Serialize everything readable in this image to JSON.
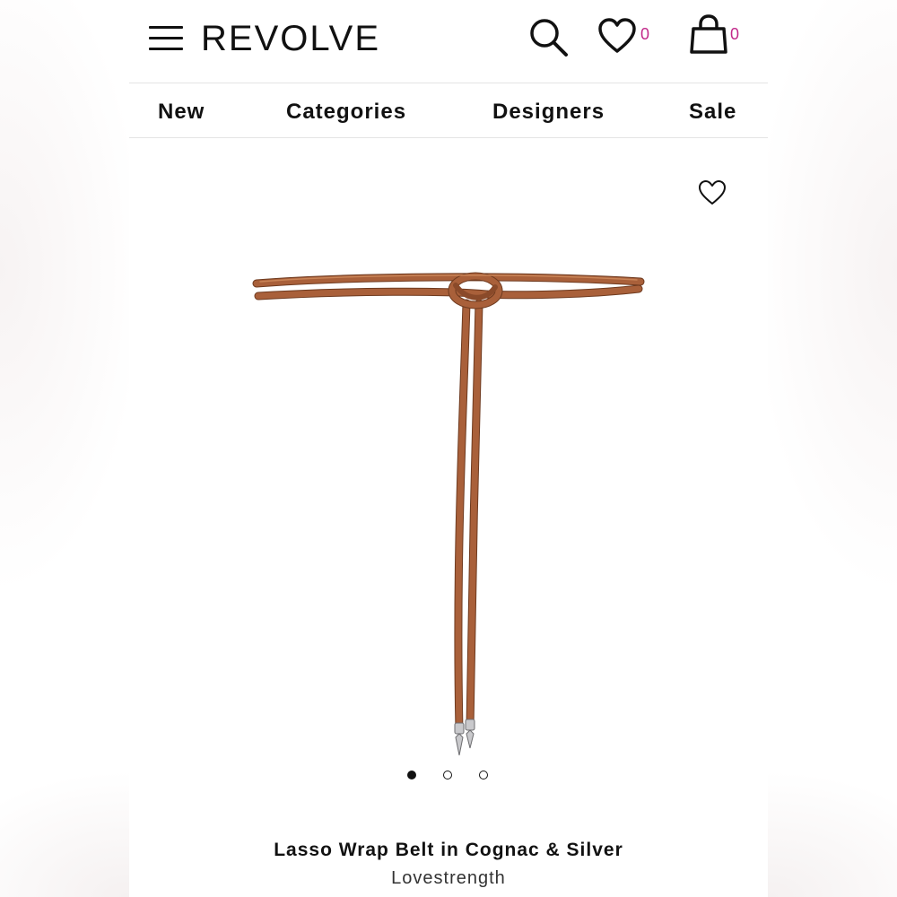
{
  "header": {
    "logo": "REVOLVE",
    "wishlist_count": "0",
    "bag_count": "0",
    "icons": {
      "menu": "hamburger-menu-icon",
      "search": "search-icon",
      "wishlist": "heart-icon",
      "bag": "shopping-bag-icon"
    },
    "count_color": "#c2298a"
  },
  "nav": {
    "items": [
      {
        "label": "New"
      },
      {
        "label": "Categories"
      },
      {
        "label": "Designers"
      },
      {
        "label": "Sale"
      }
    ]
  },
  "gallery": {
    "image_subject": "cognac leather wrap belt",
    "total_images": 3,
    "active_index": 0,
    "favorite_icon": "heart-outline-icon",
    "belt_color": "#a9603a"
  },
  "product": {
    "name": "Lasso Wrap Belt in Cognac & Silver",
    "brand": "Lovestrength"
  }
}
